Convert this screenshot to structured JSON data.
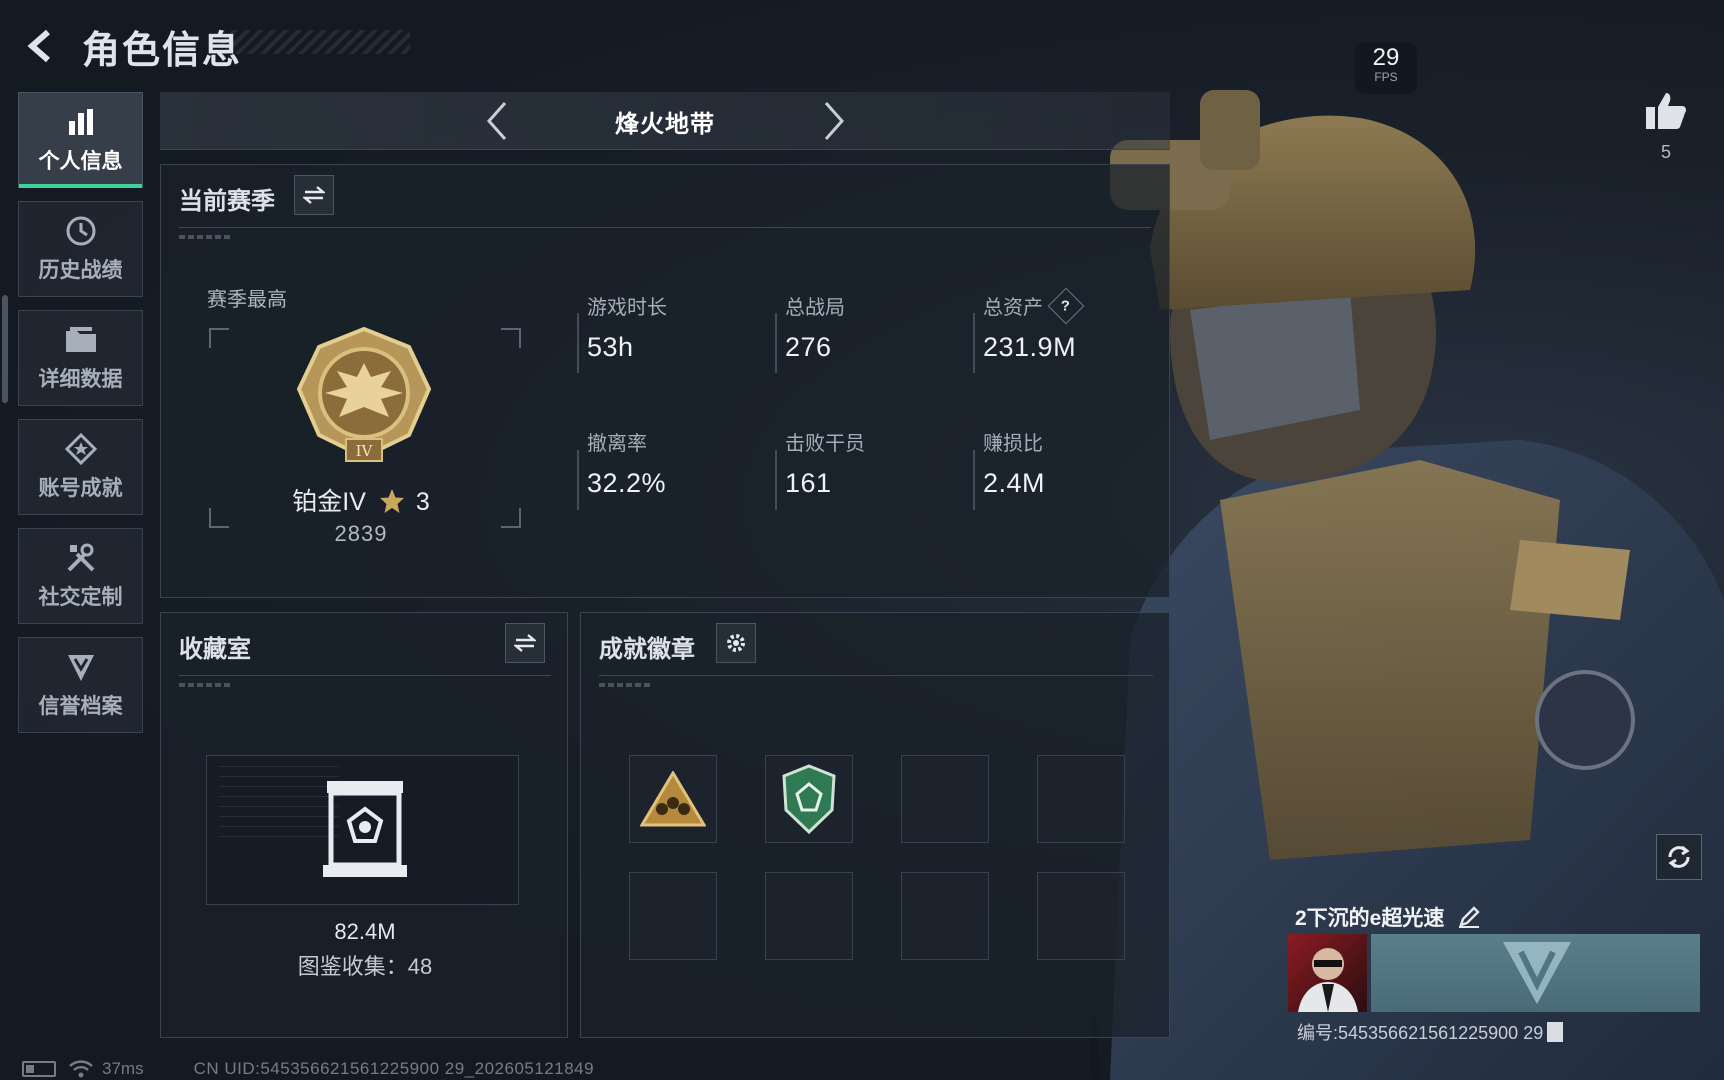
{
  "header": {
    "title": "角色信息"
  },
  "sidebar": {
    "items": [
      {
        "label": "个人信息",
        "icon": "bar-chart-icon",
        "active": true
      },
      {
        "label": "历史战绩",
        "icon": "clock-history-icon",
        "active": false
      },
      {
        "label": "详细数据",
        "icon": "folder-icon",
        "active": false
      },
      {
        "label": "账号成就",
        "icon": "achievement-star-icon",
        "active": false
      },
      {
        "label": "社交定制",
        "icon": "tools-icon",
        "active": false
      },
      {
        "label": "信誉档案",
        "icon": "reputation-shield-icon",
        "active": false
      }
    ]
  },
  "mode": {
    "title": "烽火地带"
  },
  "season": {
    "title": "当前赛季",
    "best_label": "赛季最高",
    "rank_name": "铂金IV",
    "rank_stars": "3",
    "rank_score": "2839",
    "stats": [
      {
        "label": "游戏时长",
        "value": "53h"
      },
      {
        "label": "总战局",
        "value": "276"
      },
      {
        "label": "总资产",
        "value": "231.9M",
        "help": "?"
      },
      {
        "label": "撤离率",
        "value": "32.2%"
      },
      {
        "label": "击败干员",
        "value": "161"
      },
      {
        "label": "赚损比",
        "value": "2.4M"
      }
    ]
  },
  "collection": {
    "title": "收藏室",
    "value": "82.4M",
    "count_text": "图鉴收集：48"
  },
  "badges": {
    "title": "成就徽章",
    "slots": [
      {
        "icon": "triangle-squad-badge-icon",
        "filled": true
      },
      {
        "icon": "green-shield-badge-icon",
        "filled": true
      },
      {
        "icon": "",
        "filled": false
      },
      {
        "icon": "",
        "filled": false
      },
      {
        "icon": "",
        "filled": false
      },
      {
        "icon": "",
        "filled": false
      },
      {
        "icon": "",
        "filled": false
      },
      {
        "icon": "",
        "filled": false
      }
    ]
  },
  "hud": {
    "fps_value": "29",
    "fps_label": "FPS",
    "likes": "5"
  },
  "player": {
    "name": "2下沉的e超光速",
    "id_text": "编号:545356621561225900 29"
  },
  "footer": {
    "ping": "37ms",
    "uid": "CN UID:545356621561225900 29_202605121849"
  },
  "colors": {
    "accent": "#3fd29b",
    "background": "#151c25",
    "panel_border": "#3a4451"
  }
}
